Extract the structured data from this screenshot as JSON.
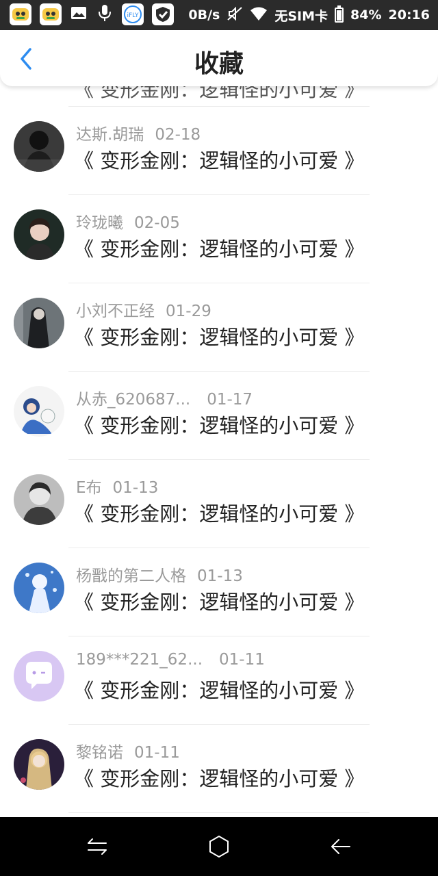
{
  "status_bar": {
    "network_speed": "0B/s",
    "sim_status": "无SIM卡",
    "battery": "84%",
    "battery_level": 0.84,
    "time": "20:16",
    "icons": [
      "app-icon",
      "app-icon",
      "image-icon",
      "mic-icon",
      "ifly-icon",
      "shield-icon",
      "mute-icon",
      "wifi-icon",
      "battery-icon"
    ]
  },
  "header": {
    "title": "收藏",
    "back_icon": "chevron-left-icon"
  },
  "colors": {
    "accent": "#2d8cf0",
    "title_text": "#222222",
    "meta_text": "#9a9a9a"
  },
  "list": {
    "partial_title": "《 变形金刚：逻辑怪的小可爱 》",
    "items": [
      {
        "name": "达斯.胡瑞",
        "date": "02-18",
        "title": "《 变形金刚：逻辑怪的小可爱 》"
      },
      {
        "name": "玲珑曦",
        "date": "02-05",
        "title": "《 变形金刚：逻辑怪的小可爱 》"
      },
      {
        "name": "小刘不正经",
        "date": "01-29",
        "title": "《 变形金刚：逻辑怪的小可爱 》"
      },
      {
        "name": "从赤_620687...",
        "date": "01-17",
        "title": "《 变形金刚：逻辑怪的小可爱 》"
      },
      {
        "name": "E布",
        "date": "01-13",
        "title": "《 变形金刚：逻辑怪的小可爱 》"
      },
      {
        "name": "杨戬的第二人格",
        "date": "01-13",
        "title": "《 变形金刚：逻辑怪的小可爱 》"
      },
      {
        "name": "189***221_62...",
        "date": "01-11",
        "title": "《 变形金刚：逻辑怪的小可爱 》"
      },
      {
        "name": "黎铭诺",
        "date": "01-11",
        "title": "《 变形金刚：逻辑怪的小可爱 》"
      }
    ]
  },
  "nav_bar": {
    "icons": [
      "switch-icon",
      "home-icon",
      "back-arrow-icon"
    ]
  }
}
